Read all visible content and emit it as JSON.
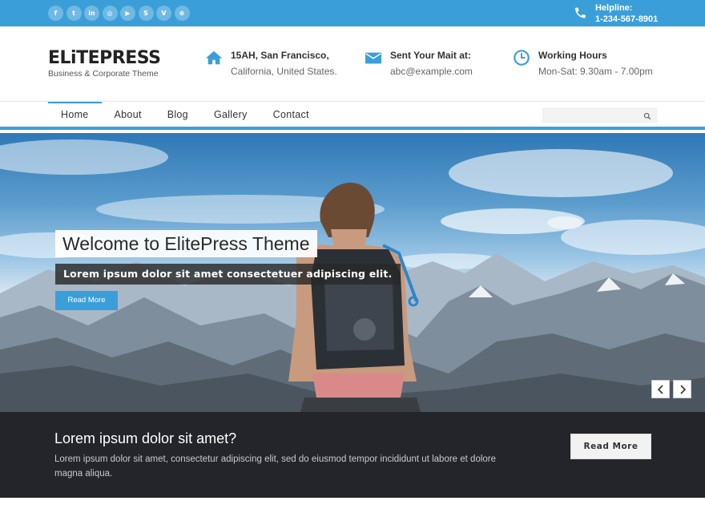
{
  "topbar": {
    "social": [
      {
        "icon": "facebook-icon",
        "glyph": "f"
      },
      {
        "icon": "twitter-icon",
        "glyph": "t"
      },
      {
        "icon": "linkedin-icon",
        "glyph": "in"
      },
      {
        "icon": "instagram-icon",
        "glyph": "◎"
      },
      {
        "icon": "youtube-icon",
        "glyph": "▶"
      },
      {
        "icon": "skype-icon",
        "glyph": "S"
      },
      {
        "icon": "vimeo-icon",
        "glyph": "V"
      },
      {
        "icon": "dribbble-icon",
        "glyph": "⊕"
      }
    ],
    "helpline_label": "Helpline:",
    "helpline_number": "1-234-567-8901"
  },
  "header": {
    "logo_name": "ELiTEPRESS",
    "logo_tagline": "Business & Corporate Theme",
    "address_line1": "15AH, San Francisco,",
    "address_line2": "California, United States.",
    "mail_label": "Sent Your Mait at:",
    "mail_value": "abc@example.com",
    "hours_label": "Working Hours",
    "hours_value": "Mon-Sat: 9.30am - 7.00pm"
  },
  "nav": {
    "items": [
      "Home",
      "About",
      "Blog",
      "Gallery",
      "Contact"
    ],
    "search_placeholder": ""
  },
  "hero": {
    "title": "Welcome to ElitePress Theme",
    "subtitle": "Lorem ipsum dolor sit amet consectetuer adipiscing elit.",
    "button": "Read More"
  },
  "band": {
    "heading": "Lorem ipsum dolor sit amet?",
    "text": "Lorem ipsum dolor sit amet, consectetur adipiscing elit, sed do eiusmod tempor incididunt ut labore et dolore magna aliqua.",
    "button": "Read More"
  },
  "colors": {
    "accent": "#3a9fd8",
    "dark_band": "#23252b"
  }
}
